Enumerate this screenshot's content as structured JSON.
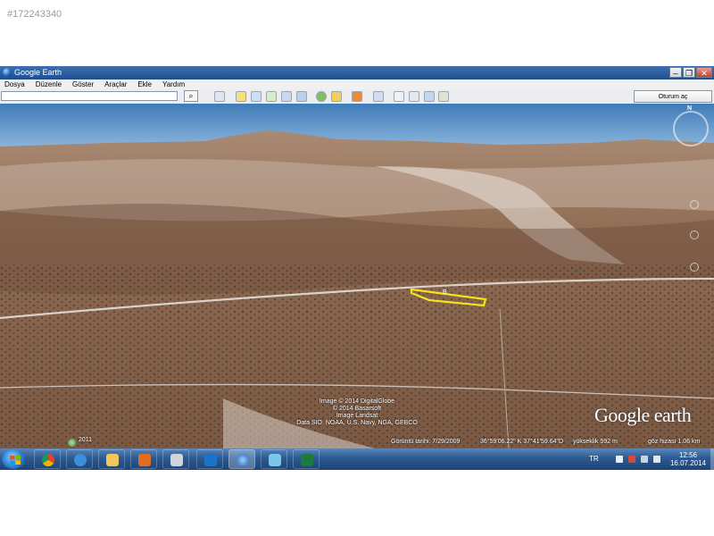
{
  "listing_id": "#172243340",
  "window": {
    "title": "Google Earth"
  },
  "menu": [
    "Dosya",
    "Düzenle",
    "Göster",
    "Araçlar",
    "Ekle",
    "Yardım"
  ],
  "toolbar": {
    "search_value": "",
    "signin_label": "Oturum aç"
  },
  "map": {
    "field_label": "B",
    "credits": [
      "Image © 2014 DigitalGlobe",
      "© 2014 Basarsoft",
      "Image Landsat",
      "Data SIO, NOAA, U.S. Navy, NGA, GEBCO"
    ],
    "logo": "Google earth",
    "year": "2011",
    "status": {
      "imagery_date": "Görüntü tarihi: 7/29/2009",
      "coords": "36°59'06.22\" K  37°41'59.64\"D",
      "elevation": "yükseklik  592 m",
      "eye_alt": "göz hizası  1.06 km"
    },
    "compass_n": "N"
  },
  "taskbar": {
    "lang": "TR",
    "time": "12:56",
    "date": "16.07.2014"
  }
}
